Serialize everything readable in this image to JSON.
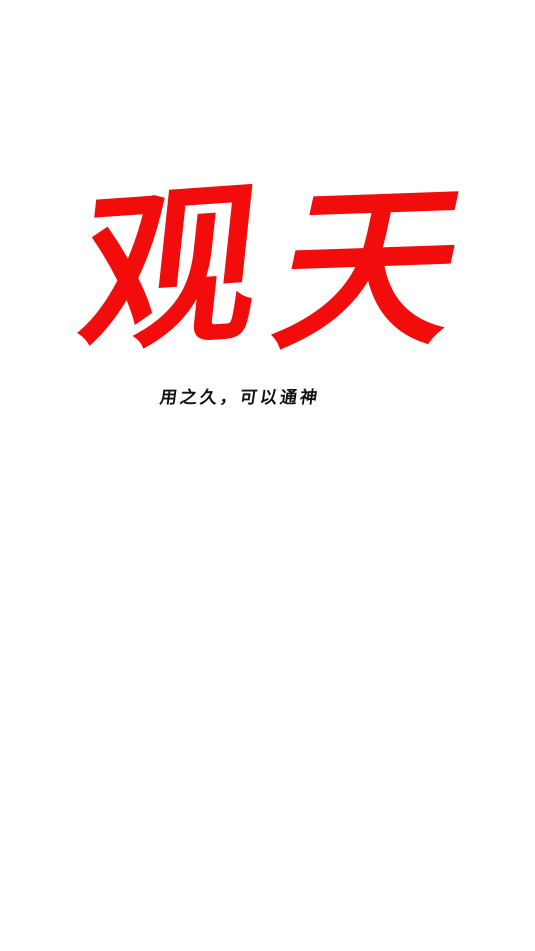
{
  "splash": {
    "logo": {
      "text": "观天",
      "char_1": "观",
      "char_2": "天",
      "color": "#f20c0c"
    },
    "slogan": "用之久，可以通神"
  }
}
